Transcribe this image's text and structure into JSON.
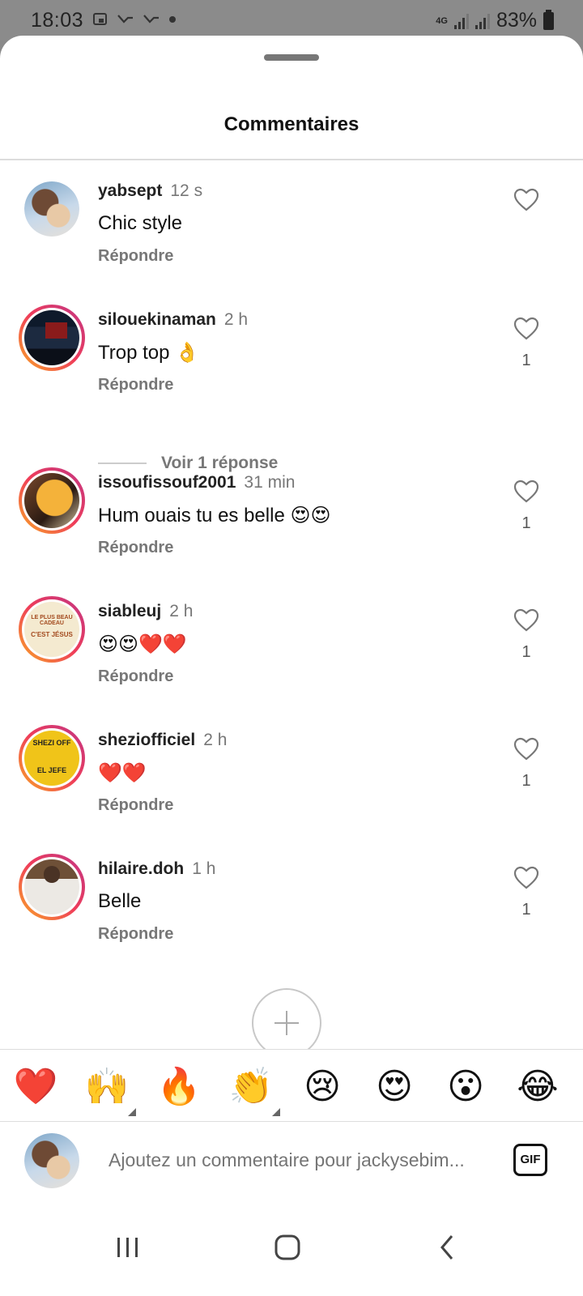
{
  "status_bar": {
    "time": "18:03",
    "network": "4G",
    "battery": "83%"
  },
  "sheet": {
    "title": "Commentaires"
  },
  "comments": [
    {
      "user": "yabsept",
      "time": "12 s",
      "text": "Chic style",
      "reply": "Répondre",
      "likes": ""
    },
    {
      "user": "silouekinaman",
      "time": "2 h",
      "text": "Trop top 👌",
      "reply": "Répondre",
      "likes": "1"
    },
    {
      "user": "issoufissouf2001",
      "time": "31 min",
      "text": "Hum ouais tu es belle 😍😍",
      "reply": "Répondre",
      "likes": "1"
    },
    {
      "user": "siableuj",
      "time": "2 h",
      "text": "😍😍❤️❤️",
      "reply": "Répondre",
      "likes": "1"
    },
    {
      "user": "sheziofficiel",
      "time": "2 h",
      "text": "❤️❤️",
      "reply": "Répondre",
      "likes": "1"
    },
    {
      "user": "hilaire.doh",
      "time": "1 h",
      "text": "Belle",
      "reply": "Répondre",
      "likes": "1"
    }
  ],
  "view_replies": "Voir 1 réponse",
  "avatar_text": {
    "siableuj_line1": "LE PLUS BEAU CADEAU",
    "siableuj_line2": "C'EST JÉSUS",
    "shezi_line1": "SHEZI OFF",
    "shezi_line2": "EL JEFE"
  },
  "quick_reactions": [
    "❤️",
    "🙌",
    "🔥",
    "👏",
    "😢",
    "😍",
    "😮",
    "😂"
  ],
  "composer": {
    "placeholder": "Ajoutez un commentaire pour jackysebim...",
    "gif_label": "GIF"
  },
  "icons": {
    "like": "heart-outline-icon",
    "add": "plus-icon",
    "nav_recent": "recent-apps-icon",
    "nav_home": "home-icon",
    "nav_back": "back-icon"
  }
}
